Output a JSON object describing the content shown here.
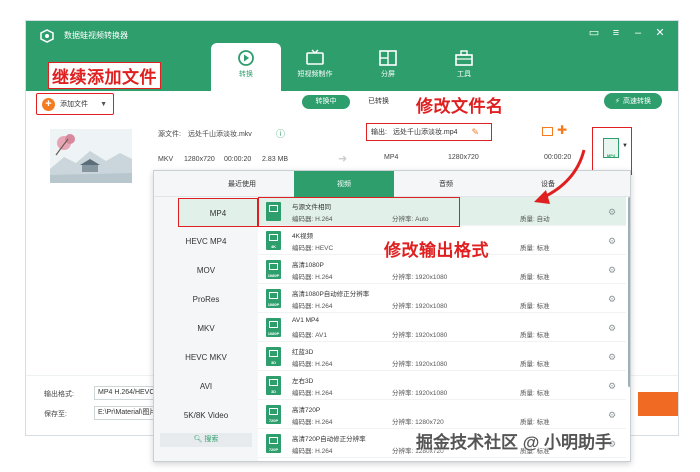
{
  "app": {
    "title": "数据蛙视频转换器",
    "icons": [
      "logo-icon",
      "chat-icon",
      "menu-icon",
      "minimize-icon",
      "close-icon"
    ]
  },
  "nav": {
    "tabs": [
      {
        "label": "转换",
        "active": true
      },
      {
        "label": "短视频制作",
        "active": false
      },
      {
        "label": "分屏",
        "active": false
      },
      {
        "label": "工具",
        "active": false
      }
    ]
  },
  "toolbar": {
    "add_file": "添加文件",
    "converting": "转换中",
    "converted": "已转换",
    "fast_convert": "高速转换"
  },
  "annotations": {
    "add": "继续添加文件",
    "rename": "修改文件名",
    "format": "修改输出格式"
  },
  "file": {
    "source_label": "源文件:",
    "source_name": "远处千山添淡妆.mkv",
    "output_label": "输出:",
    "output_name": "远处千山添淡妆.mp4",
    "in_format": "MKV",
    "in_res": "1280x720",
    "in_duration": "00:00:20",
    "in_size": "2.83 MB",
    "out_format": "MP4",
    "out_res": "1280x720",
    "out_duration": "00:00:20",
    "format_badge": "MP4"
  },
  "panel": {
    "tabs": [
      "最近使用",
      "视频",
      "音频",
      "设备"
    ],
    "active_tab": 1,
    "formats": [
      "MP4",
      "HEVC MP4",
      "MOV",
      "ProRes",
      "MKV",
      "HEVC MKV",
      "AVI",
      "5K/8K Video"
    ],
    "search": "搜索",
    "codec_label": "编码器:",
    "res_label": "分辨率:",
    "quality_label": "质量:",
    "presets": [
      {
        "name": "与源文件相同",
        "badge": "",
        "codec": "H.264",
        "res": "Auto",
        "quality": "自动"
      },
      {
        "name": "4K视频",
        "badge": "4K",
        "codec": "HEVC",
        "res": "",
        "quality": "标准"
      },
      {
        "name": "高清1080P",
        "badge": "1080P",
        "codec": "H.264",
        "res": "1920x1080",
        "quality": "标准"
      },
      {
        "name": "高清1080P自动修正分辨率",
        "badge": "1080P",
        "codec": "H.264",
        "res": "1920x1080",
        "quality": "标准"
      },
      {
        "name": "AV1 MP4",
        "badge": "1080P",
        "codec": "AV1",
        "res": "1920x1080",
        "quality": "标准"
      },
      {
        "name": "红蓝3D",
        "badge": "3D",
        "codec": "H.264",
        "res": "1920x1080",
        "quality": "标准"
      },
      {
        "name": "左右3D",
        "badge": "3D",
        "codec": "H.264",
        "res": "1920x1080",
        "quality": "标准"
      },
      {
        "name": "高清720P",
        "badge": "720P",
        "codec": "H.264",
        "res": "1280x720",
        "quality": "标准"
      },
      {
        "name": "高清720P自动修正分辨率",
        "badge": "720P",
        "codec": "H.264",
        "res": "1280x720",
        "quality": "标准"
      }
    ]
  },
  "bottom": {
    "output_format_label": "输出格式:",
    "output_format_value": "MP4 H.264/HEVC",
    "save_label": "保存至:",
    "save_path": "E:\\Pr\\Material\\图片"
  },
  "watermark": "掘金技术社区 @ 小明助手",
  "colors": {
    "brand": "#2e9e6d",
    "accent": "#f06a23",
    "annotation": "#e02020"
  }
}
